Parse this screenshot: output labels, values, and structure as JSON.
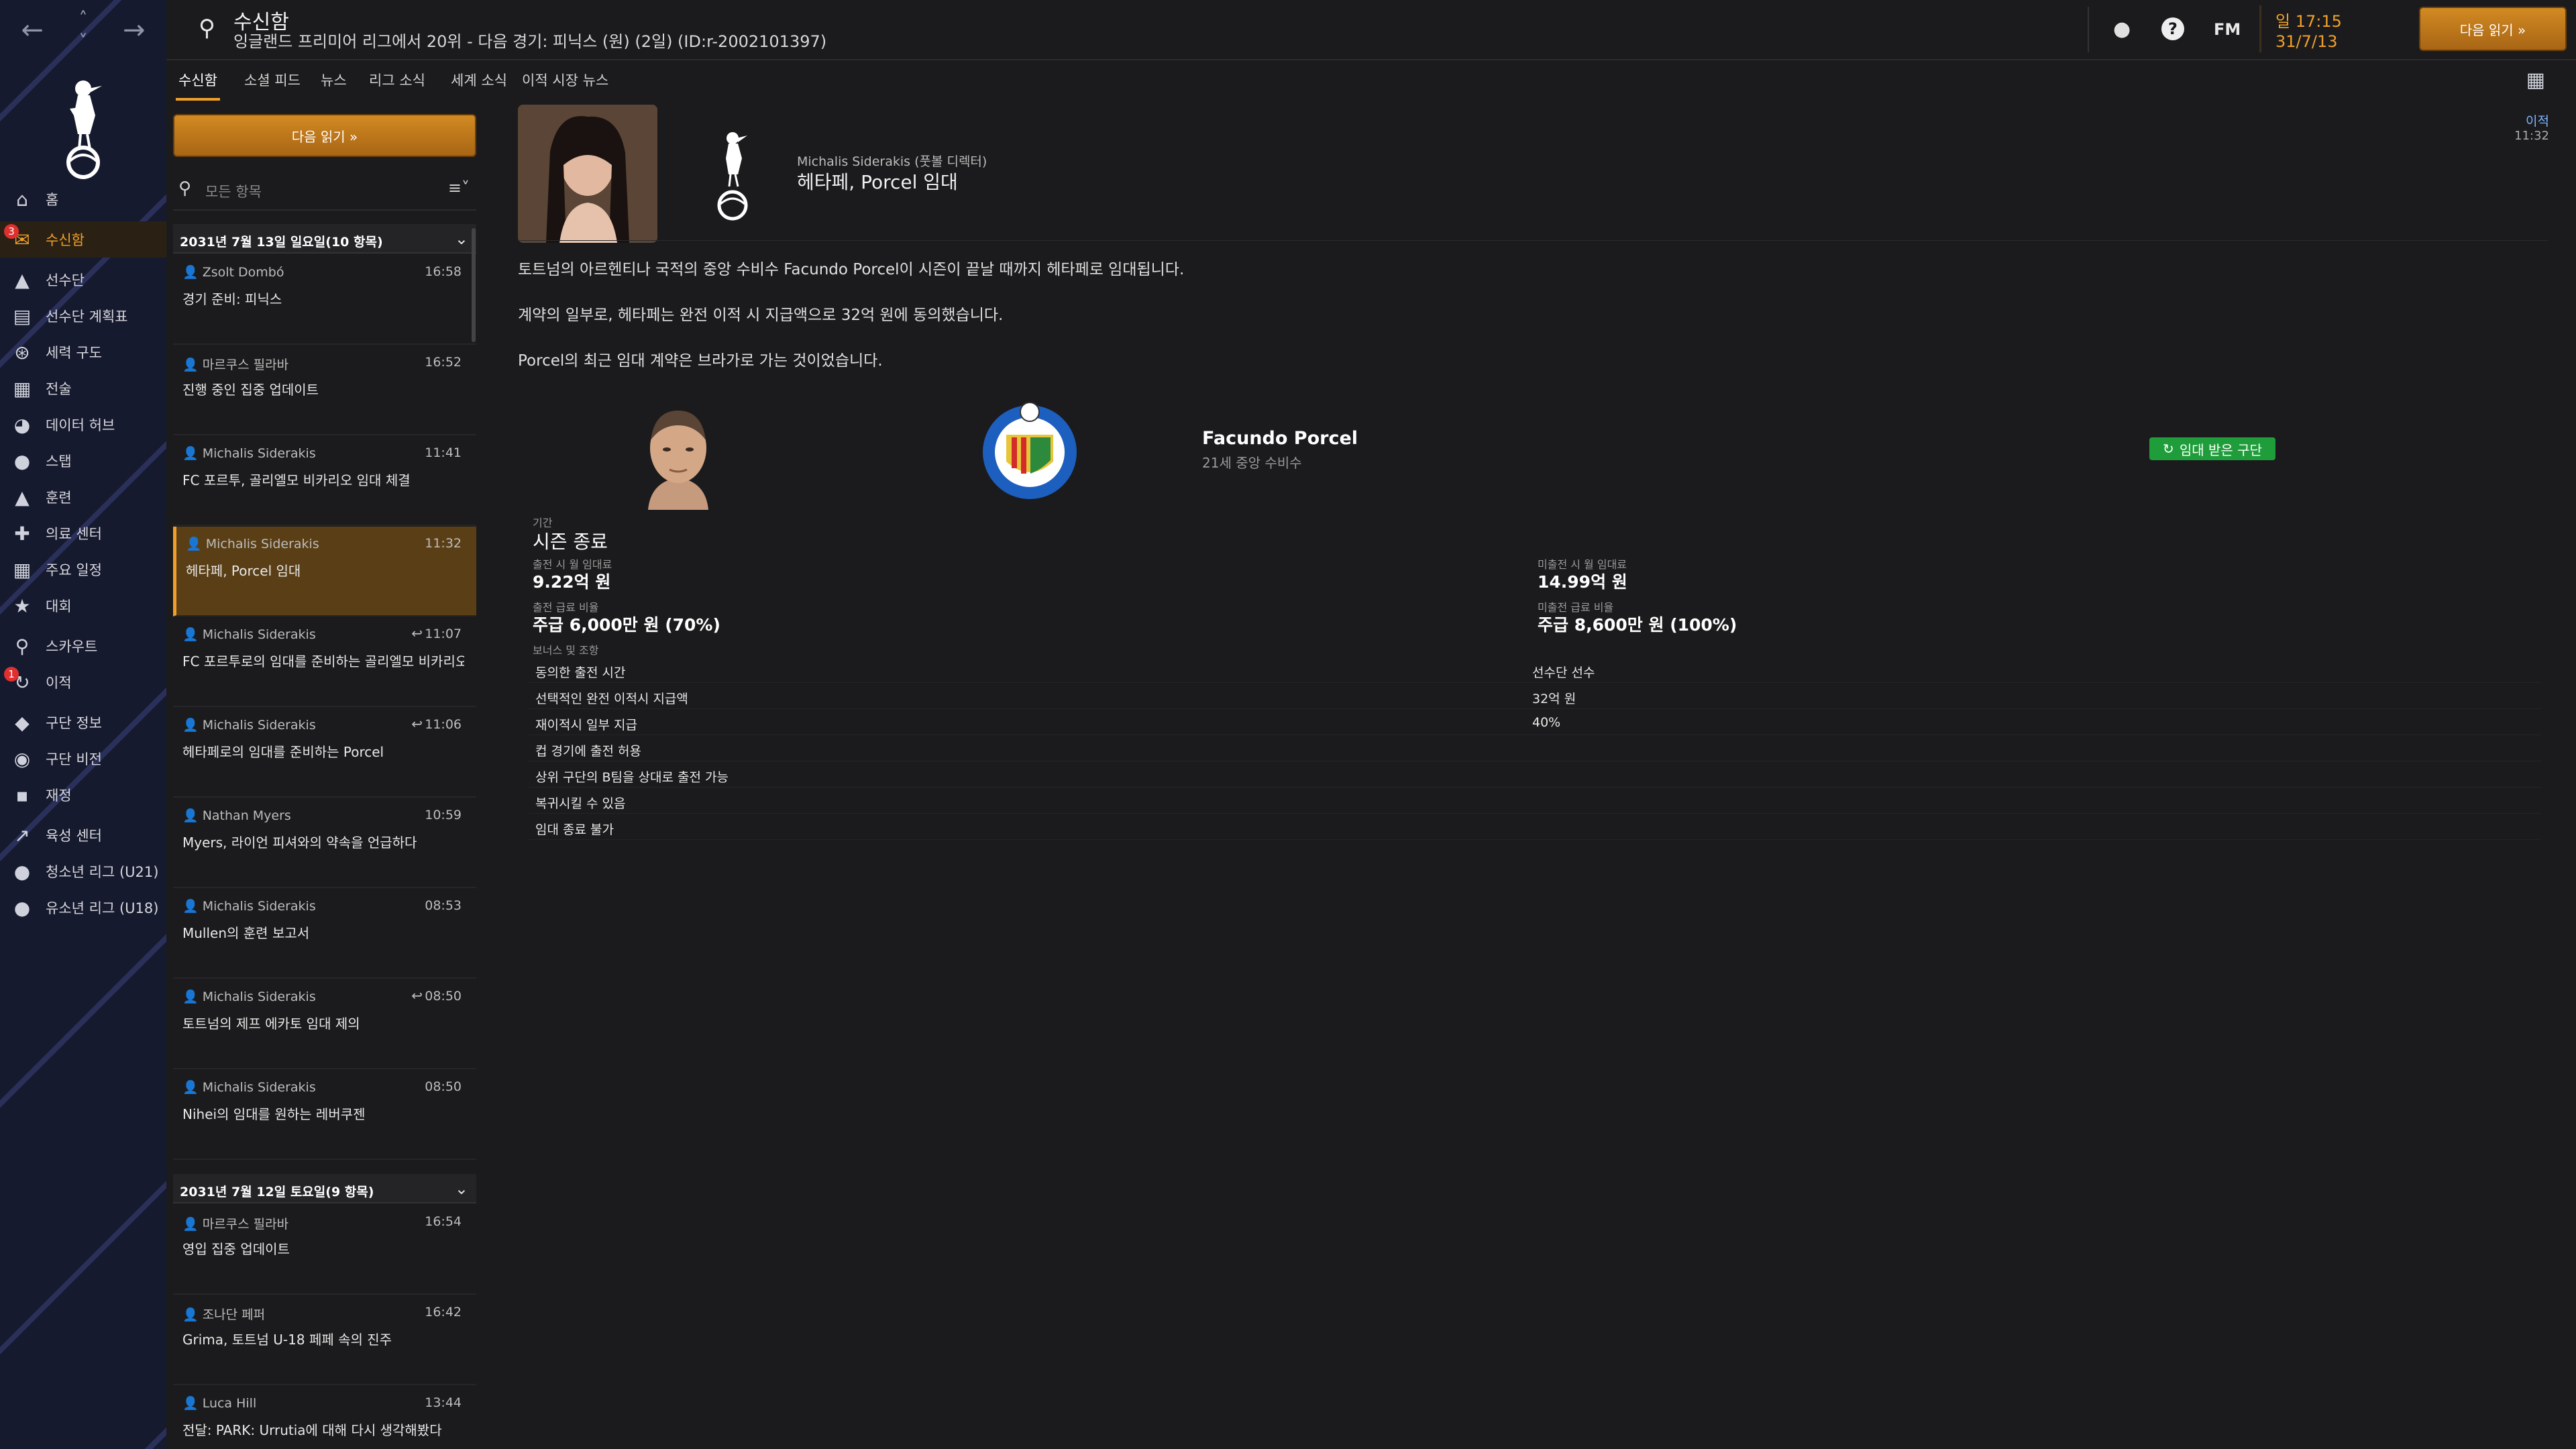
{
  "topbar": {
    "title": "수신함",
    "subtitle": "잉글랜드 프리미어 리그에서 20위 - 다음 경기: 피닉스 (원) (2일) (ID:r-2002101397)",
    "fm_logo": "FM",
    "date_time": "일 17:15",
    "date": "31/7/13",
    "continue_label": "다음 읽기 »"
  },
  "sidebar": {
    "items": [
      {
        "label": "홈",
        "icon": "home-icon"
      },
      {
        "label": "수신함",
        "icon": "inbox-icon",
        "badge": "3",
        "active": true
      },
      {
        "label": "선수단",
        "icon": "shirt-icon"
      },
      {
        "label": "선수단 계획표",
        "icon": "clipboard-icon"
      },
      {
        "label": "세력 구도",
        "icon": "hierarchy-icon"
      },
      {
        "label": "전술",
        "icon": "tactics-board-icon"
      },
      {
        "label": "데이터 허브",
        "icon": "data-hub-icon"
      },
      {
        "label": "스탭",
        "icon": "staff-icon"
      },
      {
        "label": "훈련",
        "icon": "training-cone-icon"
      },
      {
        "label": "의료 센터",
        "icon": "medical-kit-icon"
      },
      {
        "label": "주요 일정",
        "icon": "calendar-icon"
      },
      {
        "label": "대회",
        "icon": "trophy-icon"
      },
      {
        "label": "스카우트",
        "icon": "magnifier-icon"
      },
      {
        "label": "이적",
        "icon": "transfer-icon",
        "badge": "1"
      },
      {
        "label": "구단 정보",
        "icon": "shield-icon"
      },
      {
        "label": "구단 비전",
        "icon": "vision-icon"
      },
      {
        "label": "재정",
        "icon": "finance-icon"
      },
      {
        "label": "육성 센터",
        "icon": "growth-icon"
      },
      {
        "label": "청소년 리그 (U21)",
        "icon": "youth-u21-icon"
      },
      {
        "label": "유소년 리그 (U18)",
        "icon": "youth-u18-icon"
      }
    ]
  },
  "tabs": [
    "수신함",
    "소셜 피드",
    "뉴스",
    "리그 소식",
    "세계 소식",
    "이적 시장 뉴스"
  ],
  "inbox": {
    "continue_label": "다음 읽기 »",
    "filter_placeholder": "모든 항목",
    "groups": [
      {
        "title": "2031년 7월 13일 일요일(10 항목)"
      },
      {
        "title": "2031년 7월 12일 토요일(9 항목)"
      }
    ],
    "messages": [
      {
        "from": "Zsolt Dombó",
        "time": "16:58",
        "subject": "경기 준비: 피닉스"
      },
      {
        "from": "마르쿠스 필라바",
        "time": "16:52",
        "subject": "진행 중인 집중 업데이트"
      },
      {
        "from": "Michalis Siderakis",
        "time": "11:41",
        "subject": "FC 포르투, 골리엘모 비카리오 임대 체결"
      },
      {
        "from": "Michalis Siderakis",
        "time": "11:32",
        "subject": "헤타페, Porcel 임대",
        "active": true
      },
      {
        "from": "Michalis Siderakis",
        "time": "11:07",
        "subject": "FC 포르투로의 임대를 준비하는 골리엘모 비카리오",
        "reply": true
      },
      {
        "from": "Michalis Siderakis",
        "time": "11:06",
        "subject": "헤타페로의 임대를 준비하는 Porcel",
        "reply": true
      },
      {
        "from": "Nathan Myers",
        "time": "10:59",
        "subject": "Myers, 라이언 피셔와의 약속을 언급하다"
      },
      {
        "from": "Michalis Siderakis",
        "time": "08:53",
        "subject": "Mullen의 훈련 보고서"
      },
      {
        "from": "Michalis Siderakis",
        "time": "08:50",
        "subject": "토트넘의 제프 에카토 임대 제의",
        "reply": true
      },
      {
        "from": "Michalis Siderakis",
        "time": "08:50",
        "subject": "Nihei의 임대를 원하는 레버쿠젠"
      },
      {
        "from": "마르쿠스 필라바",
        "time": "16:54",
        "subject": "영입 집중 업데이트"
      },
      {
        "from": "조나단 페퍼",
        "time": "16:42",
        "subject": "Grima, 토트넘 U-18 페페 속의 진주"
      },
      {
        "from": "Luca Hill",
        "time": "13:44",
        "subject": "전달: PARK: Urrutia에 대해 다시 생각해봤다"
      }
    ]
  },
  "detail": {
    "sender": "Michalis Siderakis (풋볼 디렉터)",
    "headline": "헤타페, Porcel 임대",
    "tag": "이적",
    "tag_time": "11:32",
    "body": [
      "토트넘의 아르헨티나 국적의 중앙 수비수 Facundo Porcel이 시즌이 끝날 때까지 헤타페로 임대됩니다.",
      "계약의 일부로, 헤타페는 완전 이적 시 지급액으로 32억 원에 동의했습니다.",
      "Porcel의 최근 임대 계약은 브라가로 가는 것이었습니다."
    ],
    "player": {
      "name": "Facundo Porcel",
      "desc": "21세 중앙 수비수",
      "status": "임대 받은 구단"
    },
    "terms": {
      "period_label": "기간",
      "period": "시즌 종료",
      "appear_fee_label": "출전 시 월 임대료",
      "appear_fee": "9.22억 원",
      "non_appear_fee_label": "미출전 시 월 임대료",
      "non_appear_fee": "14.99억 원",
      "wage_label": "출전 급료 비율",
      "wage": "주급 6,000만 원 (70%)",
      "non_wage_label": "미출전 급료 비율",
      "non_wage": "주급 8,600만 원 (100%)",
      "options_label": "보너스 및 조항",
      "options": [
        {
          "k": "동의한 출전 시간",
          "v": "선수단 선수"
        },
        {
          "k": "선택적인 완전 이적시 지급액",
          "v": "32억 원"
        },
        {
          "k": "재이적시 일부 지급",
          "v": "40%"
        },
        {
          "k": "컵 경기에 출전 허용",
          "v": ""
        },
        {
          "k": "상위 구단의 B팀을 상대로 출전 가능",
          "v": ""
        },
        {
          "k": "복귀시킬 수 있음",
          "v": ""
        },
        {
          "k": "임대 종료 불가",
          "v": ""
        }
      ]
    }
  },
  "colors": {
    "accent": "#f0a028",
    "sidebar": "#161a2e",
    "status_green": "#1f9d3a"
  }
}
